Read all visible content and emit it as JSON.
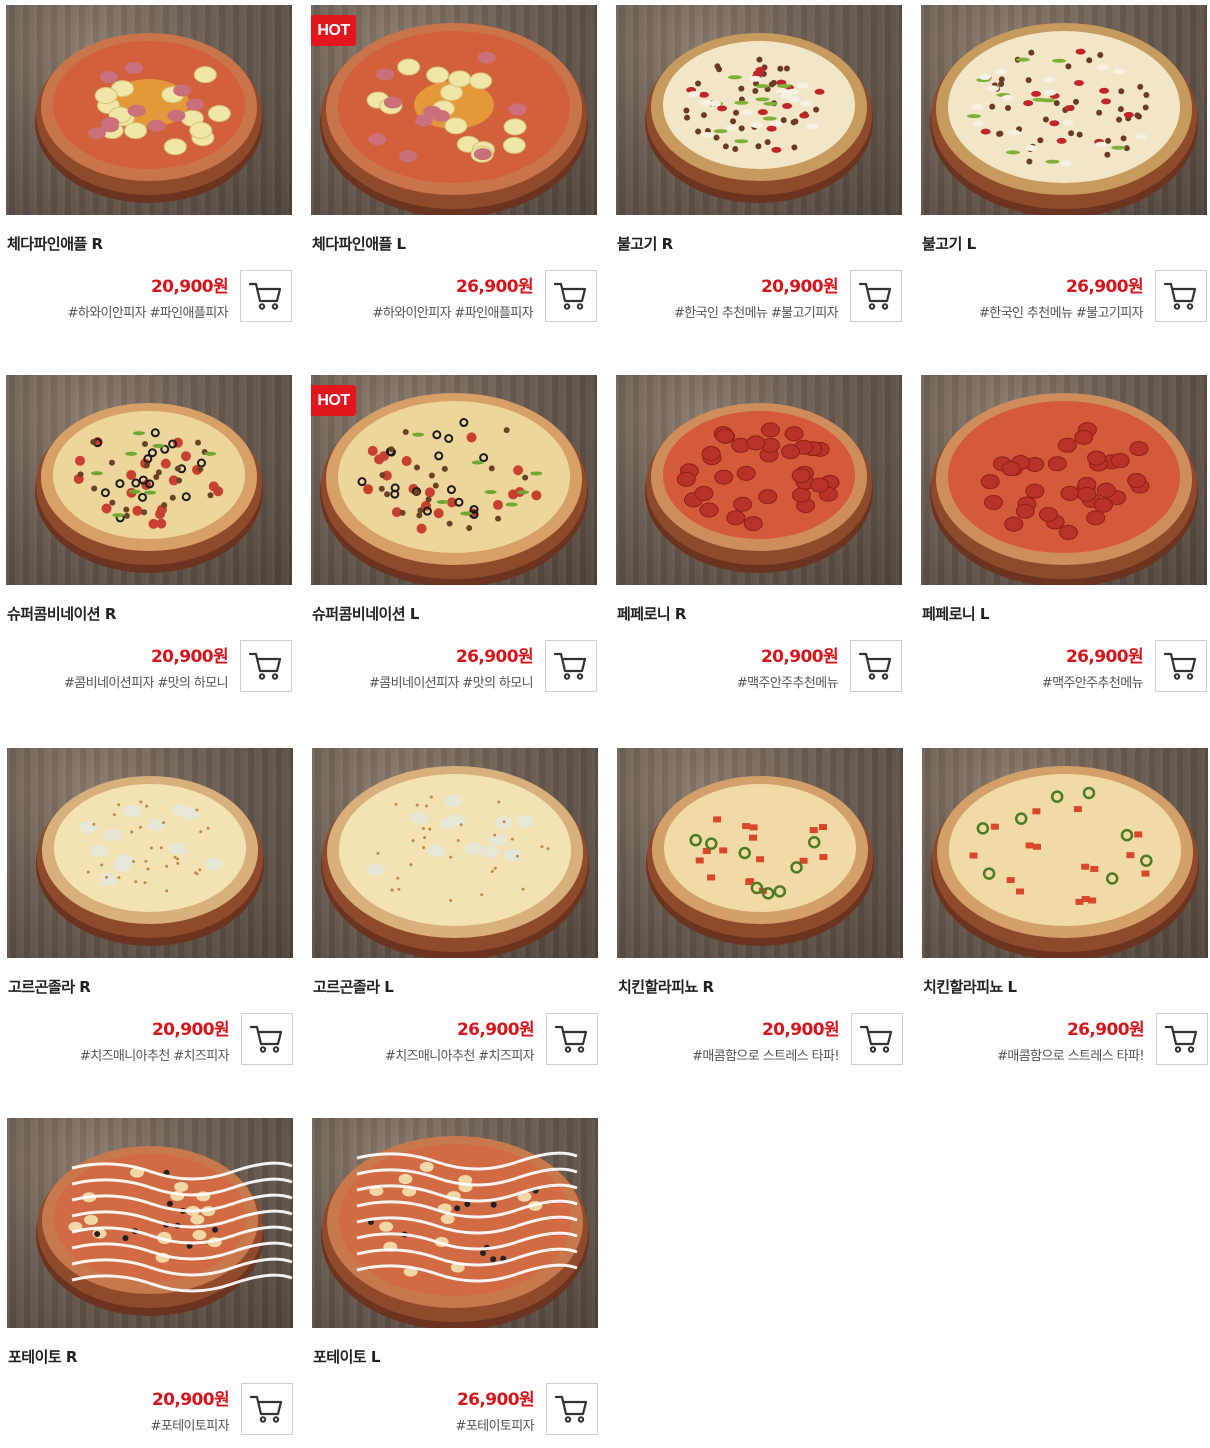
{
  "colors": {
    "price": "#d7141a",
    "hot_badge": "#e3161e",
    "cart_border": "#cfcfcf"
  },
  "icons": {
    "cart": "shopping-cart-icon"
  },
  "items": [
    {
      "name": "체다파인애플 R",
      "price": "20,900원",
      "tags": "#하와이안피자 #파인애플피자",
      "hot": "",
      "topping": "pineapple"
    },
    {
      "name": "체다파인애플 L",
      "price": "26,900원",
      "tags": "#하와이안피자 #파인애플피자",
      "hot": "HOT",
      "topping": "pineapple"
    },
    {
      "name": "불고기 R",
      "price": "20,900원",
      "tags": "#한국인 추천메뉴 #불고기피자",
      "hot": "",
      "topping": "bulgogi"
    },
    {
      "name": "불고기 L",
      "price": "26,900원",
      "tags": "#한국인 추천메뉴 #불고기피자",
      "hot": "",
      "topping": "bulgogi"
    },
    {
      "name": "슈퍼콤비네이션 R",
      "price": "20,900원",
      "tags": "#콤비네이션피자 #맛의 하모니",
      "hot": "",
      "topping": "combo"
    },
    {
      "name": "슈퍼콤비네이션 L",
      "price": "26,900원",
      "tags": "#콤비네이션피자 #맛의 하모니",
      "hot": "HOT",
      "topping": "combo"
    },
    {
      "name": "페페로니 R",
      "price": "20,900원",
      "tags": "#맥주안주추천메뉴",
      "hot": "",
      "topping": "pepperoni"
    },
    {
      "name": "페페로니 L",
      "price": "26,900원",
      "tags": "#맥주안주추천메뉴",
      "hot": "",
      "topping": "pepperoni"
    },
    {
      "name": "고르곤졸라 R",
      "price": "20,900원",
      "tags": "#치즈매니아추천 #치즈피자",
      "hot": "",
      "topping": "gorgonzola"
    },
    {
      "name": "고르곤졸라 L",
      "price": "26,900원",
      "tags": "#치즈매니아추천 #치즈피자",
      "hot": "",
      "topping": "gorgonzola"
    },
    {
      "name": "치킨할라피뇨 R",
      "price": "20,900원",
      "tags": "#매콤함으로 스트레스 타파!",
      "hot": "",
      "topping": "jalapeno"
    },
    {
      "name": "치킨할라피뇨 L",
      "price": "26,900원",
      "tags": "#매콤함으로 스트레스 타파!",
      "hot": "",
      "topping": "jalapeno"
    },
    {
      "name": "포테이토 R",
      "price": "20,900원",
      "tags": "#포테이토피자",
      "hot": "",
      "topping": "potato"
    },
    {
      "name": "포테이토 L",
      "price": "26,900원",
      "tags": "#포테이토피자",
      "hot": "",
      "topping": "potato"
    }
  ]
}
